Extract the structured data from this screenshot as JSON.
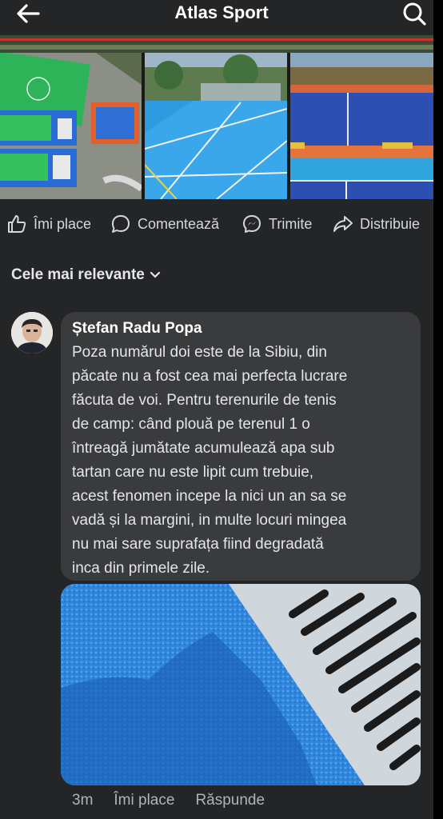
{
  "header": {
    "title": "Atlas Sport",
    "back_icon": "arrow-left-icon",
    "search_icon": "search-icon"
  },
  "post_actions": [
    {
      "label": "Îmi place",
      "icon": "like-icon"
    },
    {
      "label": "Comentează",
      "icon": "comment-icon"
    },
    {
      "label": "Trimite",
      "icon": "messenger-icon"
    },
    {
      "label": "Distribuie",
      "icon": "share-icon"
    }
  ],
  "comments_sort": {
    "label": "Cele mai relevante",
    "icon": "chevron-down-icon"
  },
  "comment": {
    "author": "Ștefan Radu Popa",
    "text": "Poza numărul doi este de la Sibiu, din\npăcate nu a fost cea mai perfecta lucrare\nfăcuta de voi. Pentru terenurile de tenis\nde camp: când plouă pe terenul 1 o\nîntreagă jumătate acumulează apa sub\ntartan care nu este lipit cum trebuie,\nacest fenomen incepe la nici un an sa se\nvadă și la margini, in multe locuri mingea\nnu mai sare suprafața fiind degradată\ninca din primele zile.",
    "time": "3m",
    "like_label": "Îmi place",
    "reply_label": "Răspunde"
  },
  "colors": {
    "background": "#242526",
    "bubble": "#3a3b3c",
    "court_blue": "#2f7fd8",
    "court_green": "#2ea55a",
    "court_orange": "#e0682e"
  }
}
